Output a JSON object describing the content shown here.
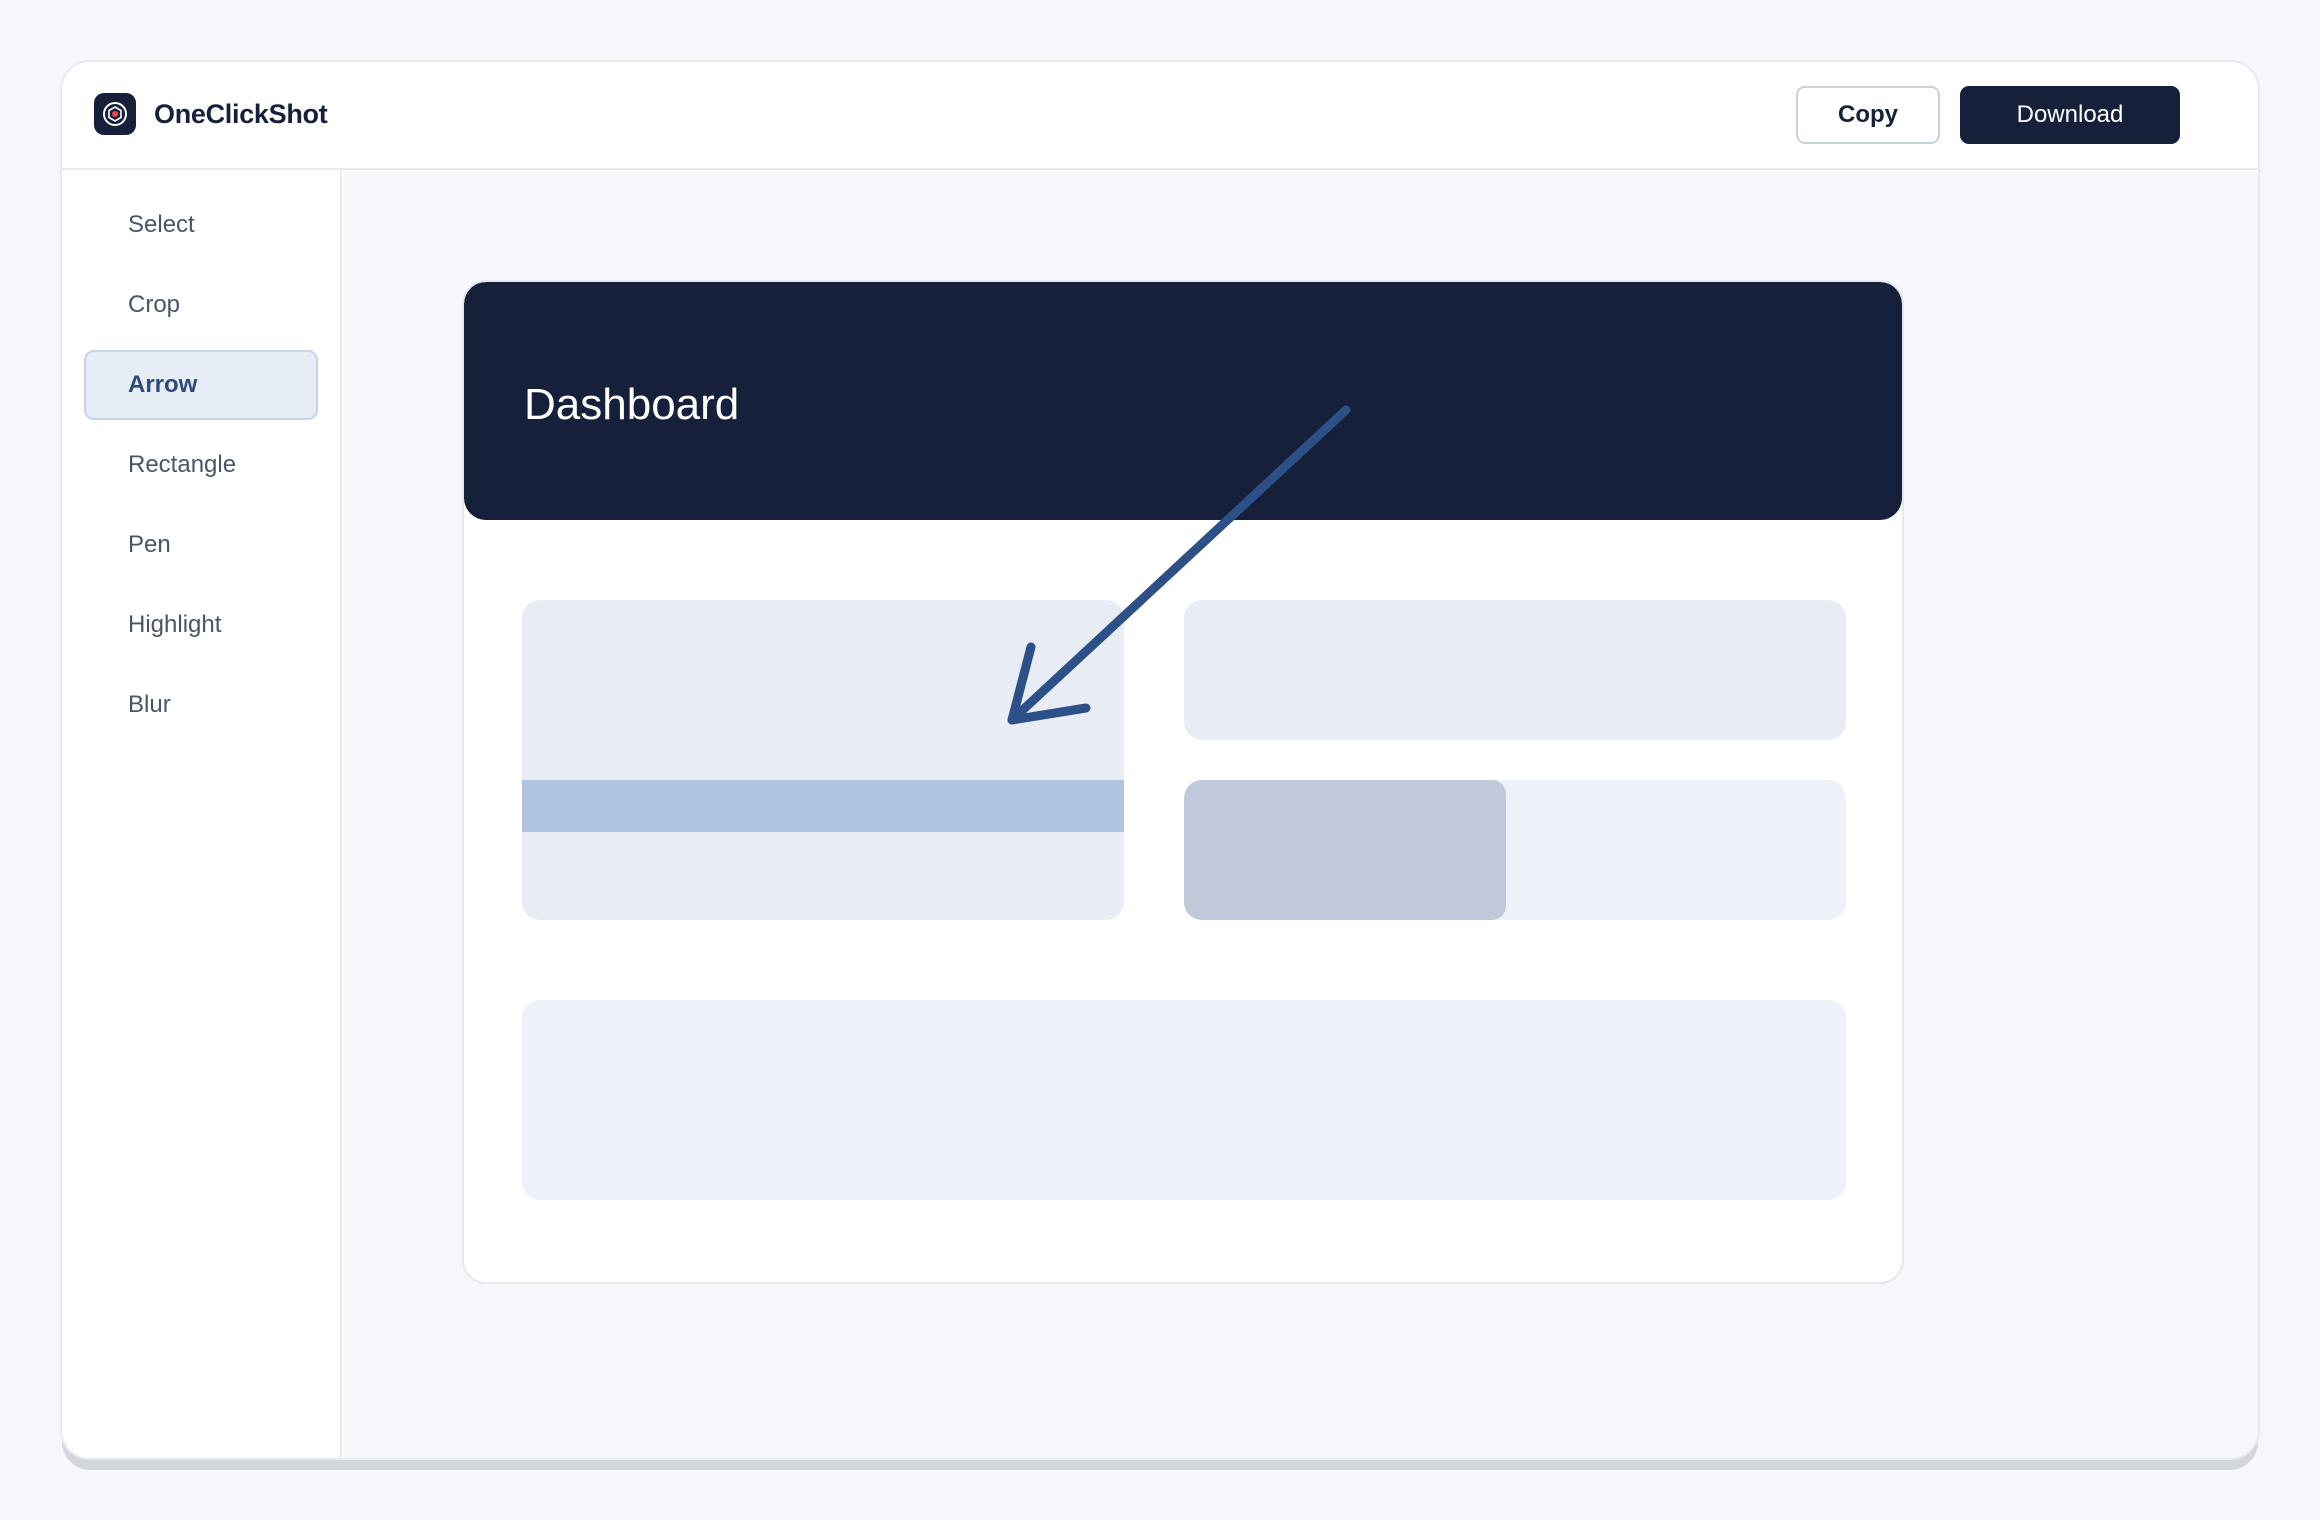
{
  "app": {
    "name": "OneClickShot",
    "logo_icon": "camera-aperture-icon"
  },
  "header": {
    "copy_label": "Copy",
    "download_label": "Download"
  },
  "sidebar": {
    "items": [
      {
        "label": "Select",
        "active": false
      },
      {
        "label": "Crop",
        "active": false
      },
      {
        "label": "Arrow",
        "active": true
      },
      {
        "label": "Rectangle",
        "active": false
      },
      {
        "label": "Pen",
        "active": false
      },
      {
        "label": "Highlight",
        "active": false
      },
      {
        "label": "Blur",
        "active": false
      }
    ]
  },
  "canvas": {
    "screenshot_title": "Dashboard",
    "annotation": {
      "tool": "arrow",
      "color": "#2e5088"
    }
  },
  "colors": {
    "brand_dark": "#16203a",
    "accent": "#2e4a7a",
    "background": "#f5f7fb"
  }
}
